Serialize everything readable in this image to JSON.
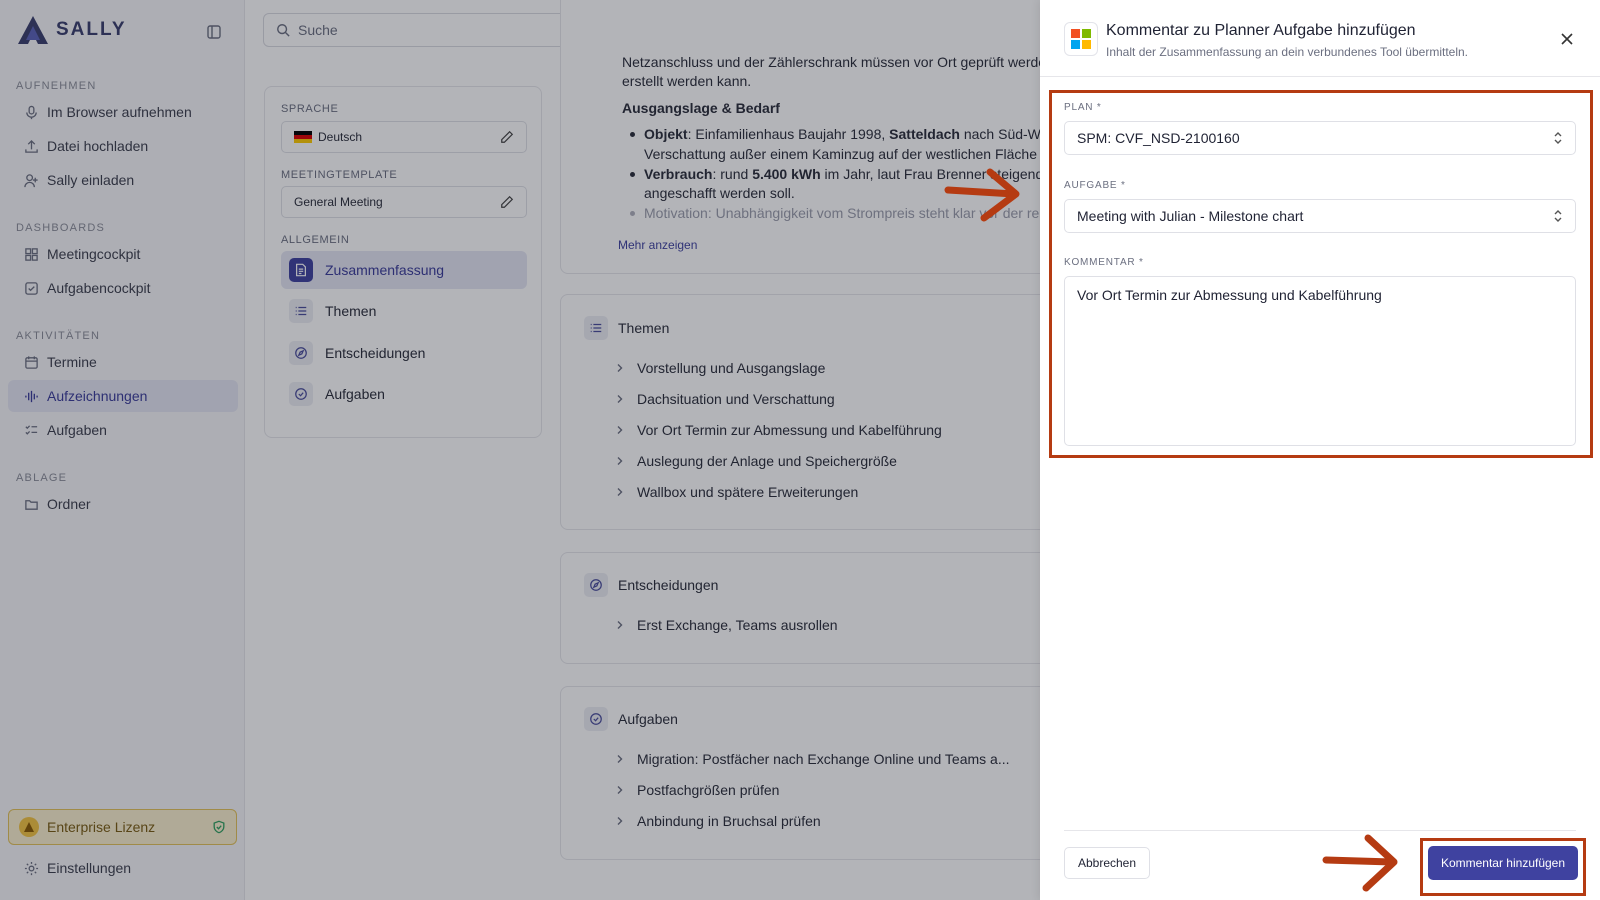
{
  "sidebar": {
    "brand": "SALLY",
    "sections": [
      {
        "title": "AUFNEHMEN",
        "items": [
          "Im Browser aufnehmen",
          "Datei hochladen",
          "Sally einladen"
        ]
      },
      {
        "title": "DASHBOARDS",
        "items": [
          "Meetingcockpit",
          "Aufgabencockpit"
        ]
      },
      {
        "title": "AKTIVITÄTEN",
        "items": [
          "Termine",
          "Aufzeichnungen",
          "Aufgaben"
        ]
      },
      {
        "title": "ABLAGE",
        "items": [
          "Ordner"
        ]
      }
    ],
    "active_item": "Aufzeichnungen",
    "license": "Enterprise Lizenz",
    "settings": "Einstellungen"
  },
  "search": {
    "placeholder": "Suche"
  },
  "settings_panel": {
    "language_label": "SPRACHE",
    "language_value": "Deutsch",
    "template_label": "MEETINGTEMPLATE",
    "template_value": "General Meeting",
    "general_label": "ALLGEMEIN",
    "sections": [
      "Zusammenfassung",
      "Themen",
      "Entscheidungen",
      "Aufgaben"
    ],
    "active_section": "Zusammenfassung"
  },
  "summary": {
    "line1": "Netzanschluss und der Zählerschrank müssen vor Ort geprüft werde",
    "line2": "erstellt werden kann.",
    "heading": "Ausgangslage & Bedarf",
    "b1_label": "Objekt",
    "b1_text": ": Einfamilienhaus Baujahr 1998, ",
    "b1_bold": "Satteldach",
    "b1_rest": " nach Süd-Wes",
    "b1_line2": "Verschattung außer einem Kaminzug auf der westlichen Fläche (",
    "b2_label": "Verbrauch",
    "b2_text": ": rund ",
    "b2_bold": "5.400 kWh",
    "b2_rest": " im Jahr, laut Frau Brenner steigend,",
    "b2_line2": "angeschafft werden soll.",
    "b3_label": "Motivation",
    "b3_text": ": Unabhängigkeit vom Strompreis steht klar vor der re",
    "more": "Mehr anzeigen"
  },
  "topics": {
    "title": "Themen",
    "items": [
      "Vorstellung und Ausgangslage",
      "Dachsituation und Verschattung",
      "Vor Ort Termin zur Abmessung und Kabelführung",
      "Auslegung der Anlage und Speichergröße",
      "Wallbox und spätere Erweiterungen"
    ]
  },
  "decisions": {
    "title": "Entscheidungen",
    "items": [
      "Erst Exchange, Teams ausrollen"
    ]
  },
  "tasks": {
    "title": "Aufgaben",
    "items": [
      "Migration: Postfächer nach Exchange Online und Teams a...",
      "Postfachgrößen prüfen",
      "Anbindung in Bruchsal prüfen"
    ]
  },
  "dialog": {
    "title": "Kommentar zu Planner Aufgabe hinzufügen",
    "subtitle": "Inhalt der Zusammenfassung an dein verbundenes Tool übermitteln.",
    "plan_label": "PLAN *",
    "plan_value": "SPM: CVF_NSD-2100160",
    "task_label": "AUFGABE *",
    "task_value": "Meeting with Julian - Milestone chart",
    "comment_label": "KOMMENTAR *",
    "comment_value": "Vor Ort Termin zur Abmessung und Kabelführung",
    "cancel": "Abbrechen",
    "submit": "Kommentar hinzufügen"
  },
  "colors": {
    "accent": "#3f42a0",
    "highlight": "#b53b12",
    "license_bg": "#fbf1cf"
  }
}
